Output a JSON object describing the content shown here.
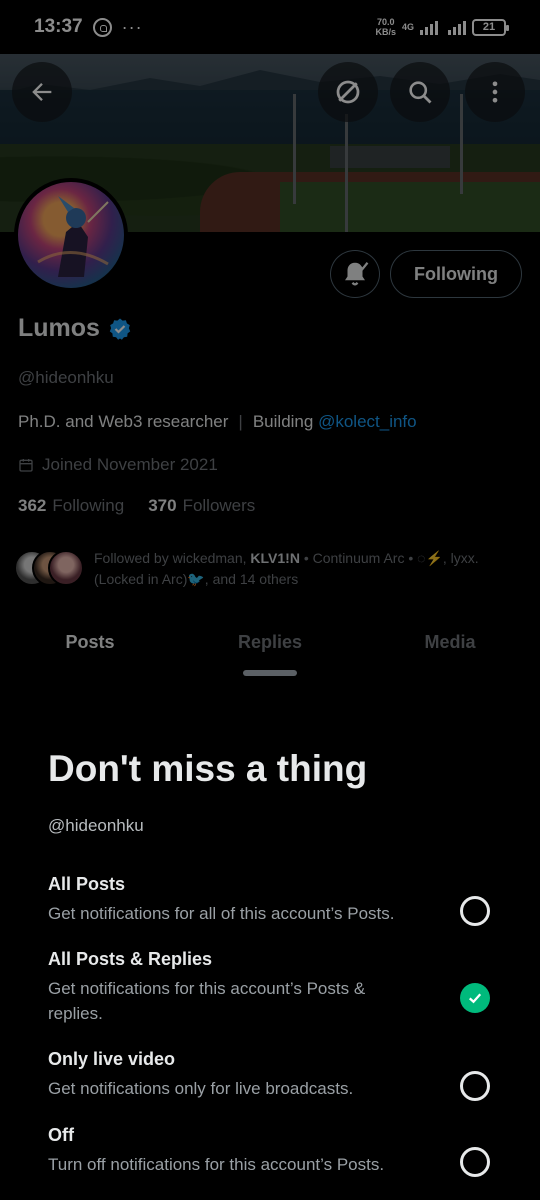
{
  "status_bar": {
    "time": "13:37",
    "more": "···",
    "speed_value": "70.0",
    "speed_unit": "KB/s",
    "network": "4G",
    "battery": "21"
  },
  "header": {
    "back_icon": "arrow-left-icon",
    "grok_icon": "grok-icon",
    "search_icon": "search-icon",
    "more_icon": "more-vertical-icon"
  },
  "profile": {
    "following_label": "Following",
    "name": "Lumos",
    "handle": "@hideonhku",
    "bio_text": "Ph.D. and Web3 researcher",
    "bio_sep": "|",
    "bio_building": "Building",
    "bio_link": "@kolect_info",
    "joined": "Joined November 2021",
    "following_count": "362",
    "following_label_small": "Following",
    "followers_count": "370",
    "followers_label": "Followers",
    "followed_by_prefix": "Followed by wickedman,",
    "followed_by_bold": "KLV1!N",
    "followed_by_rest": "• Continuum Arc • ◌⚡, lyxx.(Locked in Arc)🐦, and 14 others"
  },
  "tabs": [
    {
      "label": "Posts"
    },
    {
      "label": "Replies"
    },
    {
      "label": "Media"
    }
  ],
  "sheet": {
    "title": "Don't miss a thing",
    "handle": "@hideonhku",
    "options": [
      {
        "title": "All Posts",
        "desc": "Get notifications for all of this account’s Posts.",
        "selected": false
      },
      {
        "title": "All Posts & Replies",
        "desc": "Get notifications for this account’s Posts & replies.",
        "selected": true
      },
      {
        "title": "Only live video",
        "desc": "Get notifications only for live broadcasts.",
        "selected": false
      },
      {
        "title": "Off",
        "desc": "Turn off notifications for this account’s Posts.",
        "selected": false
      }
    ]
  },
  "colors": {
    "accent": "#1d9bf0",
    "check": "#00ba7c",
    "background": "#000000"
  }
}
